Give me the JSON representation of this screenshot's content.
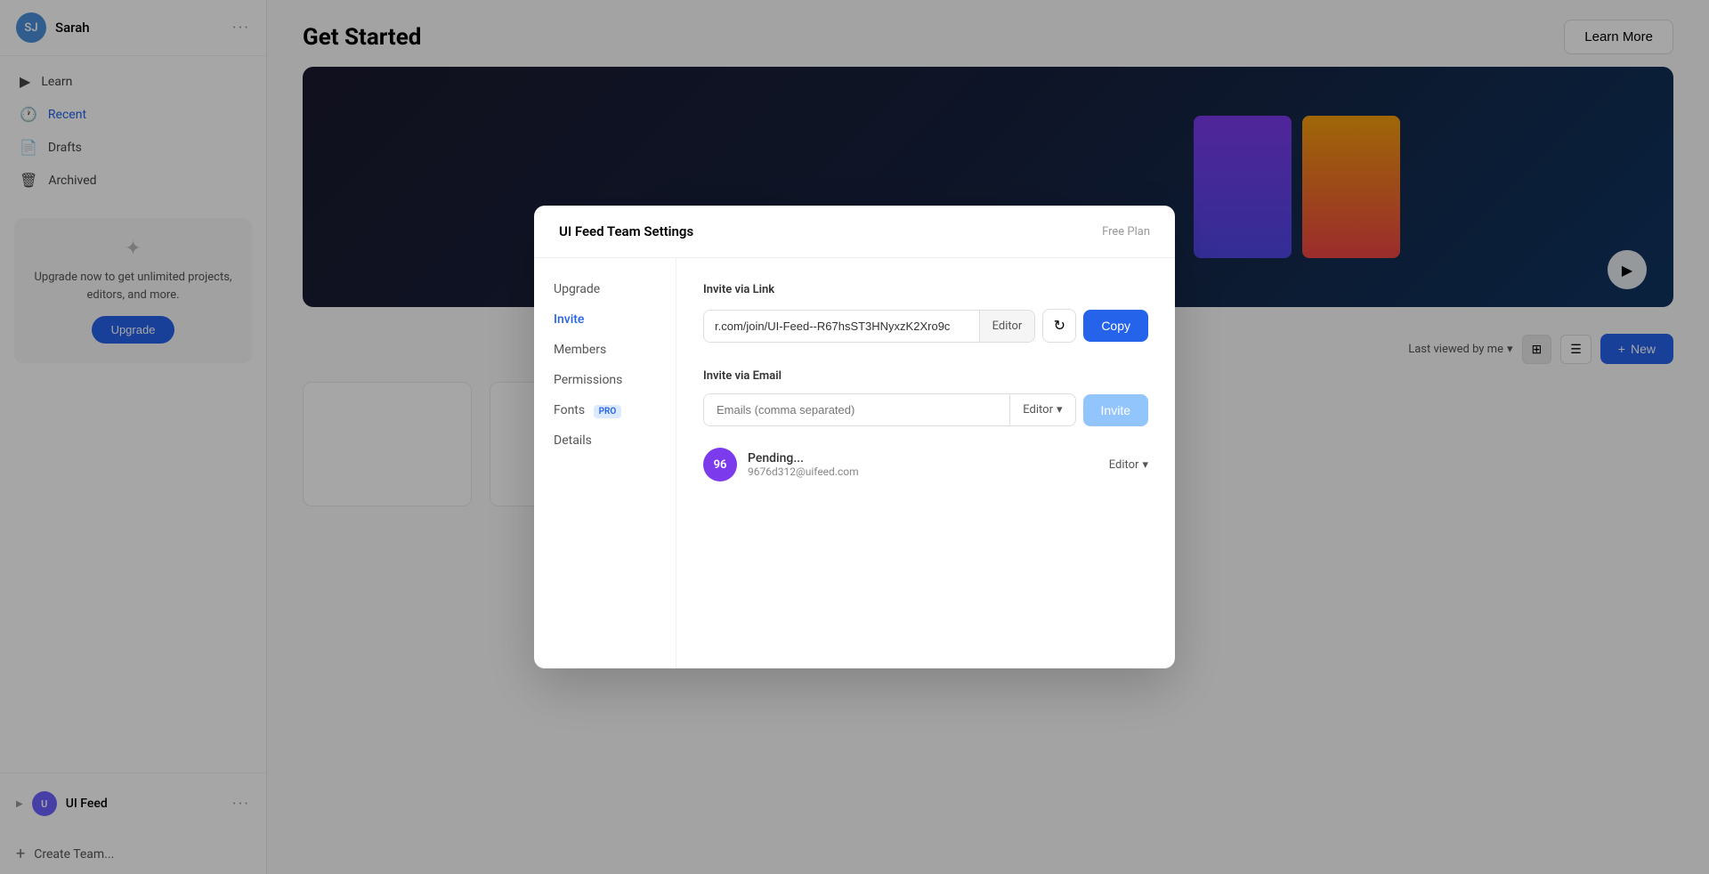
{
  "sidebar": {
    "user": {
      "name": "Sarah",
      "initials": "SJ",
      "avatar_color": "#4a90d9"
    },
    "nav": [
      {
        "id": "learn",
        "label": "Learn",
        "icon": "▶",
        "active": false
      },
      {
        "id": "recent",
        "label": "Recent",
        "icon": "🕐",
        "active": true
      },
      {
        "id": "drafts",
        "label": "Drafts",
        "icon": "📄",
        "active": false
      },
      {
        "id": "archived",
        "label": "Archived",
        "icon": "🗑",
        "active": false
      }
    ],
    "upgrade_card": {
      "text": "Upgrade now to get unlimited projects, editors, and more.",
      "button_label": "Upgrade"
    },
    "team": {
      "name": "UI Feed",
      "initials": "U",
      "avatar_color": "#6c63ff"
    },
    "create_team_label": "Create Team..."
  },
  "main": {
    "title": "Get Started",
    "learn_more_label": "Learn More",
    "new_button_label": "New",
    "sort_label": "Last viewed by me",
    "plus_icon": "+"
  },
  "modal": {
    "title": "UI Feed Team Settings",
    "plan_label": "Free Plan",
    "nav": [
      {
        "id": "upgrade",
        "label": "Upgrade",
        "active": false
      },
      {
        "id": "invite",
        "label": "Invite",
        "active": true
      },
      {
        "id": "members",
        "label": "Members",
        "active": false
      },
      {
        "id": "permissions",
        "label": "Permissions",
        "active": false
      },
      {
        "id": "fonts",
        "label": "Fonts",
        "active": false,
        "pro": true
      },
      {
        "id": "details",
        "label": "Details",
        "active": false
      }
    ],
    "invite_via_link": {
      "section_label": "Invite via Link",
      "link_value": "r.com/join/UI-Feed--R67hsST3HNyxzK2Xro9c",
      "role_label": "Editor",
      "copy_button_label": "Copy",
      "refresh_icon": "↻"
    },
    "invite_via_email": {
      "section_label": "Invite via Email",
      "email_placeholder": "Emails (comma separated)",
      "role_label": "Editor",
      "chevron": "▾",
      "invite_button_label": "Invite"
    },
    "pending_invites": [
      {
        "initials": "96",
        "avatar_color": "#7c3aed",
        "status": "Pending...",
        "email": "9676d312@uifeed.com",
        "role": "Editor"
      }
    ],
    "pro_badge_label": "PRO"
  }
}
